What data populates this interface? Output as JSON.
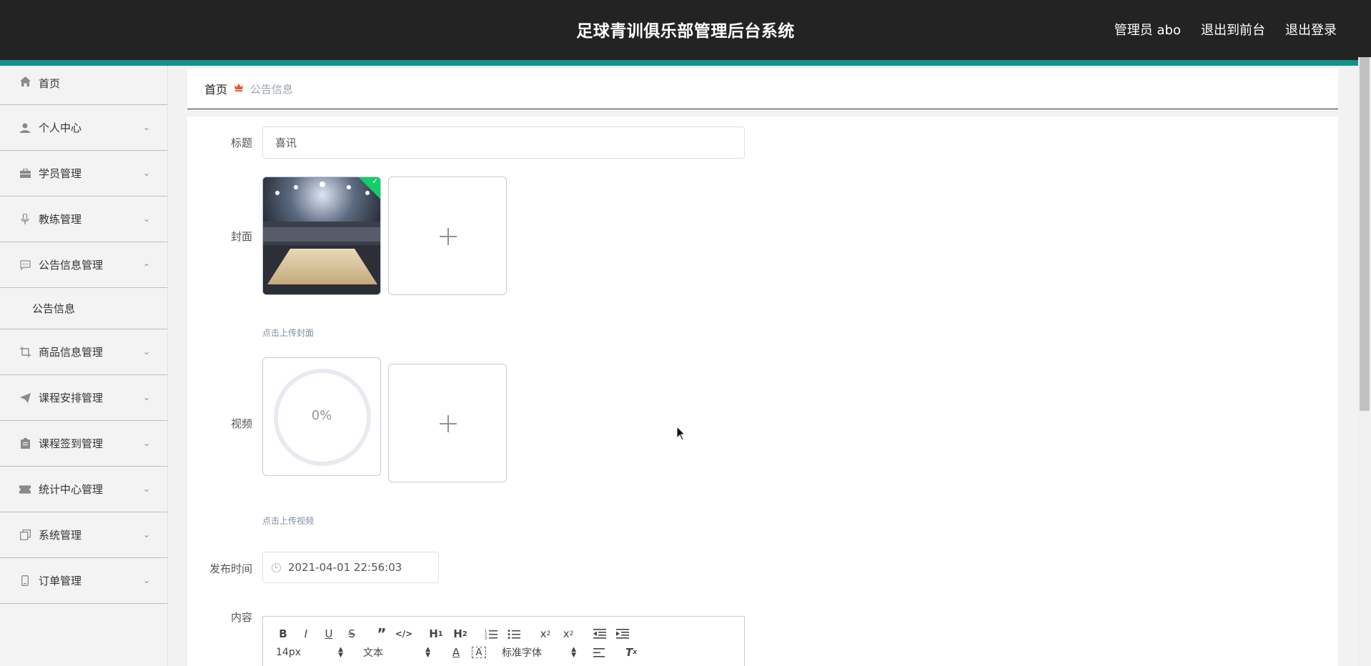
{
  "app": {
    "title": "足球青训俱乐部管理后台系统"
  },
  "top_links": {
    "admin": "管理员 abo",
    "front": "退出到前台",
    "logout": "退出登录"
  },
  "colors": {
    "topbar": "#232323",
    "accent": "#12918a",
    "badge": "#13ce66",
    "crumb_icon": "#e3572d"
  },
  "sidebar": {
    "home": {
      "label": "首页",
      "icon": "home-icon"
    },
    "items": [
      {
        "label": "个人中心",
        "icon": "user-icon"
      },
      {
        "label": "学员管理",
        "icon": "briefcase-icon"
      },
      {
        "label": "教练管理",
        "icon": "microphone-icon"
      },
      {
        "label": "公告信息管理",
        "icon": "chat-icon",
        "expanded": true
      },
      {
        "label": "商品信息管理",
        "icon": "crop-icon"
      },
      {
        "label": "课程安排管理",
        "icon": "paper-plane-icon"
      },
      {
        "label": "课程签到管理",
        "icon": "clipboard-icon"
      },
      {
        "label": "统计中心管理",
        "icon": "ticket-icon"
      },
      {
        "label": "系统管理",
        "icon": "copy-icon"
      },
      {
        "label": "订单管理",
        "icon": "phone-icon"
      }
    ],
    "sub_item": "公告信息"
  },
  "breadcrumb": {
    "home": "首页",
    "current": "公告信息"
  },
  "form": {
    "title_label": "标题",
    "title_value": "喜讯",
    "cover_label": "封面",
    "cover_hint": "点击上传封面",
    "video_label": "视频",
    "video_progress": "0%",
    "video_hint": "点击上传视频",
    "time_label": "发布时间",
    "time_value": "2021-04-01 22:56:03",
    "content_label": "内容"
  },
  "editor": {
    "row1": [
      "B",
      "I",
      "U",
      "S",
      "”",
      "</>",
      "H1",
      "H2",
      "ol",
      "ul",
      "x2sub",
      "x2sup",
      "outdent",
      "indent"
    ],
    "size": "14px",
    "header": "文本",
    "font": "标准字体"
  }
}
